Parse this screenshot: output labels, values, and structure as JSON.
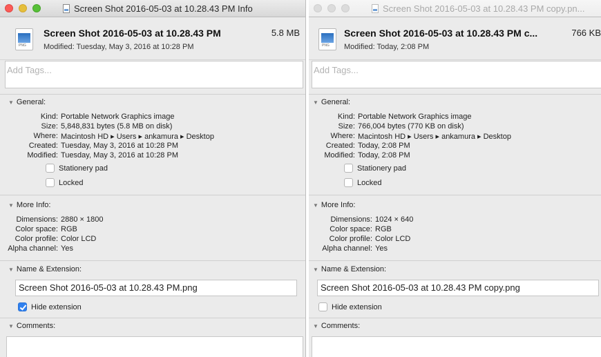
{
  "left": {
    "window_title": "Screen Shot 2016-05-03 at 10.28.43 PM Info",
    "file_name": "Screen Shot 2016-05-03 at 10.28.43 PM",
    "file_size": "5.8 MB",
    "modified_line": "Modified: Tuesday, May 3, 2016 at 10:28 PM",
    "icon_tag": "PNG",
    "tags_placeholder": "Add Tags...",
    "general": {
      "heading": "General:",
      "rows": [
        {
          "label": "Kind:",
          "value": "Portable Network Graphics image"
        },
        {
          "label": "Size:",
          "value": "5,848,831 bytes (5.8 MB on disk)"
        },
        {
          "label": "Where:",
          "value": "Macintosh HD ▸ Users ▸ ankamura ▸ Desktop"
        },
        {
          "label": "Created:",
          "value": "Tuesday, May 3, 2016 at 10:28 PM"
        },
        {
          "label": "Modified:",
          "value": "Tuesday, May 3, 2016 at 10:28 PM"
        }
      ],
      "stationery": "Stationery pad",
      "locked": "Locked"
    },
    "more_info": {
      "heading": "More Info:",
      "rows": [
        {
          "label": "Dimensions:",
          "value": "2880 × 1800"
        },
        {
          "label": "Color space:",
          "value": "RGB"
        },
        {
          "label": "Color profile:",
          "value": "Color LCD"
        },
        {
          "label": "Alpha channel:",
          "value": "Yes"
        }
      ]
    },
    "name_ext": {
      "heading": "Name & Extension:",
      "value": "Screen Shot 2016-05-03 at 10.28.43 PM.png",
      "hide_extension": "Hide extension",
      "hide_checked": true
    },
    "comments_heading": "Comments:"
  },
  "right": {
    "window_title": "Screen Shot 2016-05-03 at 10.28.43 PM copy.pn...",
    "file_name": "Screen Shot 2016-05-03 at 10.28.43 PM c...",
    "file_size": "766 KB",
    "modified_line": "Modified: Today, 2:08 PM",
    "icon_tag": "PNG",
    "tags_placeholder": "Add Tags...",
    "general": {
      "heading": "General:",
      "rows": [
        {
          "label": "Kind:",
          "value": "Portable Network Graphics image"
        },
        {
          "label": "Size:",
          "value": "766,004 bytes (770 KB on disk)"
        },
        {
          "label": "Where:",
          "value": "Macintosh HD ▸ Users ▸ ankamura ▸ Desktop"
        },
        {
          "label": "Created:",
          "value": "Today, 2:08 PM"
        },
        {
          "label": "Modified:",
          "value": "Today, 2:08 PM"
        }
      ],
      "stationery": "Stationery pad",
      "locked": "Locked"
    },
    "more_info": {
      "heading": "More Info:",
      "rows": [
        {
          "label": "Dimensions:",
          "value": "1024 × 640"
        },
        {
          "label": "Color space:",
          "value": "RGB"
        },
        {
          "label": "Color profile:",
          "value": "Color LCD"
        },
        {
          "label": "Alpha channel:",
          "value": "Yes"
        }
      ]
    },
    "name_ext": {
      "heading": "Name & Extension:",
      "value": "Screen Shot 2016-05-03 at 10.28.43 PM copy.png",
      "hide_extension": "Hide extension",
      "hide_checked": false
    },
    "comments_heading": "Comments:"
  },
  "colors": {
    "close": "#fc5b57",
    "minimize": "#e5bf3c",
    "zoom": "#57c038",
    "checkbox_checked": "#2f80ef"
  }
}
